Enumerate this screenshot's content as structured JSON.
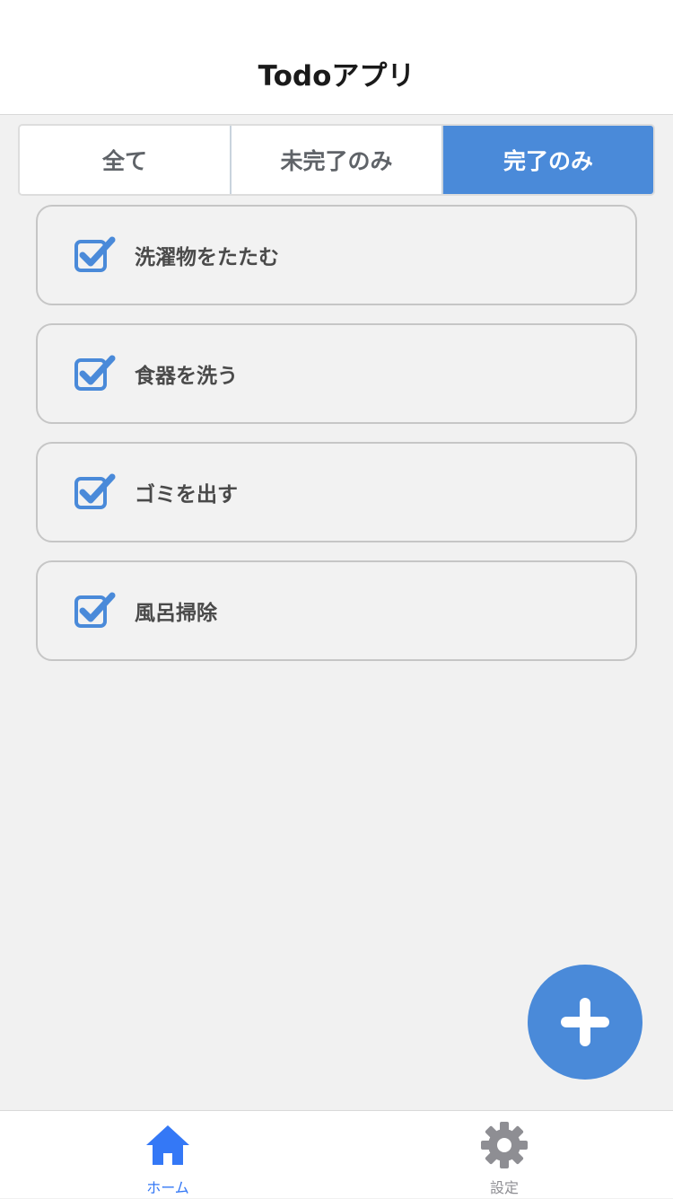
{
  "header": {
    "title": "Todoアプリ"
  },
  "filters": [
    {
      "label": "全て",
      "selected": false
    },
    {
      "label": "未完了のみ",
      "selected": false
    },
    {
      "label": "完了のみ",
      "selected": true
    }
  ],
  "todos": [
    {
      "title": "洗濯物をたたむ",
      "done": true
    },
    {
      "title": "食器を洗う",
      "done": true
    },
    {
      "title": "ゴミを出す",
      "done": true
    },
    {
      "title": "風呂掃除",
      "done": true
    }
  ],
  "fab": {
    "icon": "plus-icon"
  },
  "tabs": [
    {
      "label": "ホーム",
      "icon": "home-icon",
      "active": true
    },
    {
      "label": "設定",
      "icon": "gear-icon",
      "active": false
    }
  ],
  "colors": {
    "accent": "#4a8ad9",
    "tab_active": "#3478f6",
    "tab_inactive": "#8e8e93"
  }
}
